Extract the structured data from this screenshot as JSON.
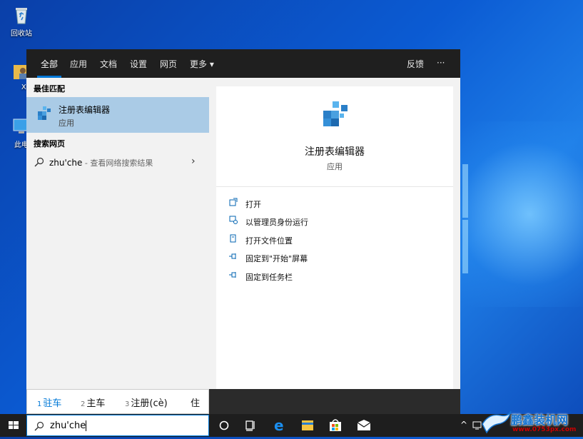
{
  "desktop": {
    "icons": [
      {
        "label": "回收站",
        "icon": "recycle-bin-icon"
      },
      {
        "label": "XU",
        "icon": "user-folder-icon"
      },
      {
        "label": "此电",
        "icon": "this-pc-icon"
      }
    ]
  },
  "search_panel": {
    "tabs": [
      {
        "label": "全部",
        "active": true
      },
      {
        "label": "应用"
      },
      {
        "label": "文档"
      },
      {
        "label": "设置"
      },
      {
        "label": "网页"
      },
      {
        "label": "更多 ▾"
      }
    ],
    "feedback_label": "反馈",
    "more_options": "···",
    "best_match_heading": "最佳匹配",
    "best_match": {
      "title": "注册表编辑器",
      "subtitle": "应用",
      "icon": "registry-editor-icon"
    },
    "web_heading": "搜索网页",
    "web_result": {
      "query": "zhu'che",
      "suffix": " - 查看网络搜索结果"
    },
    "detail": {
      "title": "注册表编辑器",
      "subtitle": "应用",
      "actions": [
        {
          "label": "打开",
          "icon": "open-icon"
        },
        {
          "label": "以管理员身份运行",
          "icon": "run-as-admin-icon"
        },
        {
          "label": "打开文件位置",
          "icon": "file-location-icon"
        },
        {
          "label": "固定到\"开始\"屏幕",
          "icon": "pin-icon"
        },
        {
          "label": "固定到任务栏",
          "icon": "pin-icon"
        }
      ]
    }
  },
  "ime": {
    "candidates": [
      {
        "num": "1",
        "text": "驻车",
        "selected": true
      },
      {
        "num": "2",
        "text": "主车"
      },
      {
        "num": "3",
        "text": "注册(cè)"
      },
      {
        "num": "",
        "text": "住"
      }
    ]
  },
  "taskbar": {
    "search_text": "zhu'che",
    "tray_icon": "^"
  },
  "watermark": {
    "text": "鹏鑫装机网",
    "url": "www.0753px.com"
  },
  "colors": {
    "accent": "#0078d7",
    "selected_bg": "#aacbe6",
    "topbar_bg": "#1f1f1f"
  }
}
